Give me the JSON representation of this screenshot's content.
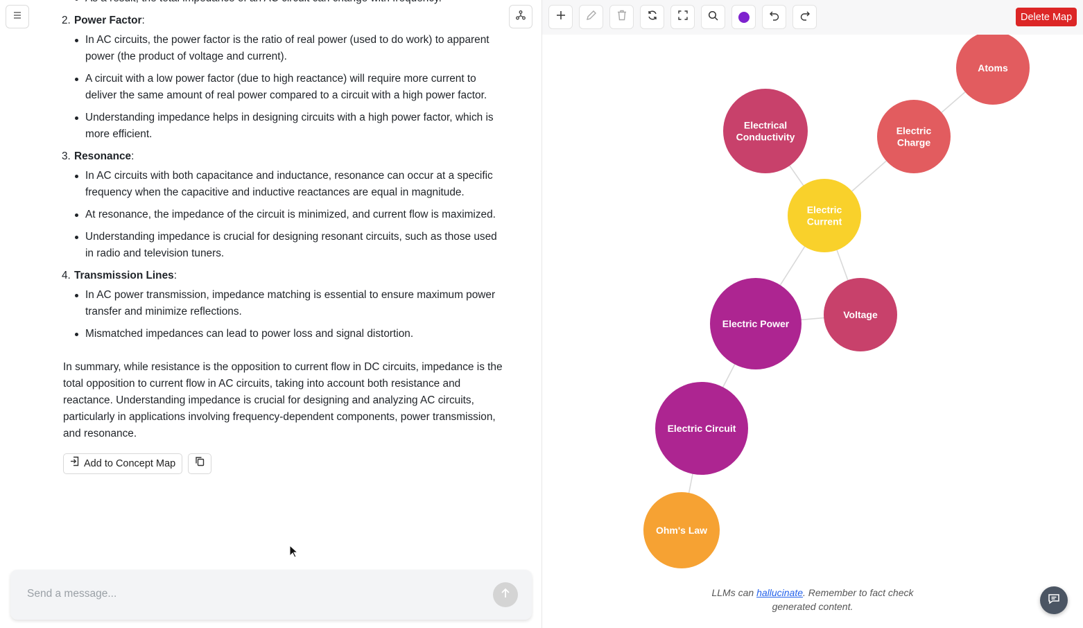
{
  "chat": {
    "clipped_line": "As a result, the total impedance of an AC circuit can change with frequency.",
    "sections": [
      {
        "number": "2.",
        "title": "Power Factor",
        "bullets": [
          "In AC circuits, the power factor is the ratio of real power (used to do work) to apparent power (the product of voltage and current).",
          "A circuit with a low power factor (due to high reactance) will require more current to deliver the same amount of real power compared to a circuit with a high power factor.",
          "Understanding impedance helps in designing circuits with a high power factor, which is more efficient."
        ]
      },
      {
        "number": "3.",
        "title": "Resonance",
        "bullets": [
          "In AC circuits with both capacitance and inductance, resonance can occur at a specific frequency when the capacitive and inductive reactances are equal in magnitude.",
          "At resonance, the impedance of the circuit is minimized, and current flow is maximized.",
          "Understanding impedance is crucial for designing resonant circuits, such as those used in radio and television tuners."
        ]
      },
      {
        "number": "4.",
        "title": "Transmission Lines",
        "bullets": [
          "In AC power transmission, impedance matching is essential to ensure maximum power transfer and minimize reflections.",
          "Mismatched impedances can lead to power loss and signal distortion."
        ]
      }
    ],
    "summary": "In summary, while resistance is the opposition to current flow in DC circuits, impedance is the total opposition to current flow in AC circuits, taking into account both resistance and reactance. Understanding impedance is crucial for designing and analyzing AC circuits, particularly in applications involving frequency-dependent components, power transmission, and resonance.",
    "add_to_map_label": "Add to Concept Map",
    "composer_placeholder": "Send a message..."
  },
  "map": {
    "toolbar": {
      "buttons": [
        "add-icon",
        "edit-icon",
        "delete-icon",
        "refresh-icon",
        "fit-view-icon",
        "search-icon",
        "color-picker-icon",
        "undo-icon",
        "redo-icon"
      ],
      "color_swatch": "#7e22ce",
      "delete_label": "Delete Map"
    },
    "nodes": [
      {
        "id": "atoms",
        "label": "Atoms",
        "color": "#e25c5f"
      },
      {
        "id": "conductivity",
        "label": "Electrical Conductivity",
        "color": "#c8416b"
      },
      {
        "id": "charge",
        "label": "Electric Charge",
        "color": "#e25c5f"
      },
      {
        "id": "current",
        "label": "Electric Current",
        "color": "#f9d12b"
      },
      {
        "id": "power",
        "label": "Electric Power",
        "color": "#ad2591"
      },
      {
        "id": "voltage",
        "label": "Voltage",
        "color": "#c8416b"
      },
      {
        "id": "circuit",
        "label": "Electric Circuit",
        "color": "#ad2591"
      },
      {
        "id": "ohms",
        "label": "Ohm's Law",
        "color": "#f6a233"
      }
    ],
    "edges": [
      [
        "atoms",
        "charge"
      ],
      [
        "charge",
        "current"
      ],
      [
        "conductivity",
        "current"
      ],
      [
        "current",
        "power"
      ],
      [
        "current",
        "voltage"
      ],
      [
        "power",
        "voltage"
      ],
      [
        "power",
        "circuit"
      ],
      [
        "circuit",
        "ohms"
      ]
    ],
    "disclaimer_prefix": "LLMs can ",
    "disclaimer_link": "hallucinate",
    "disclaimer_suffix": ". Remember to fact check generated content."
  }
}
